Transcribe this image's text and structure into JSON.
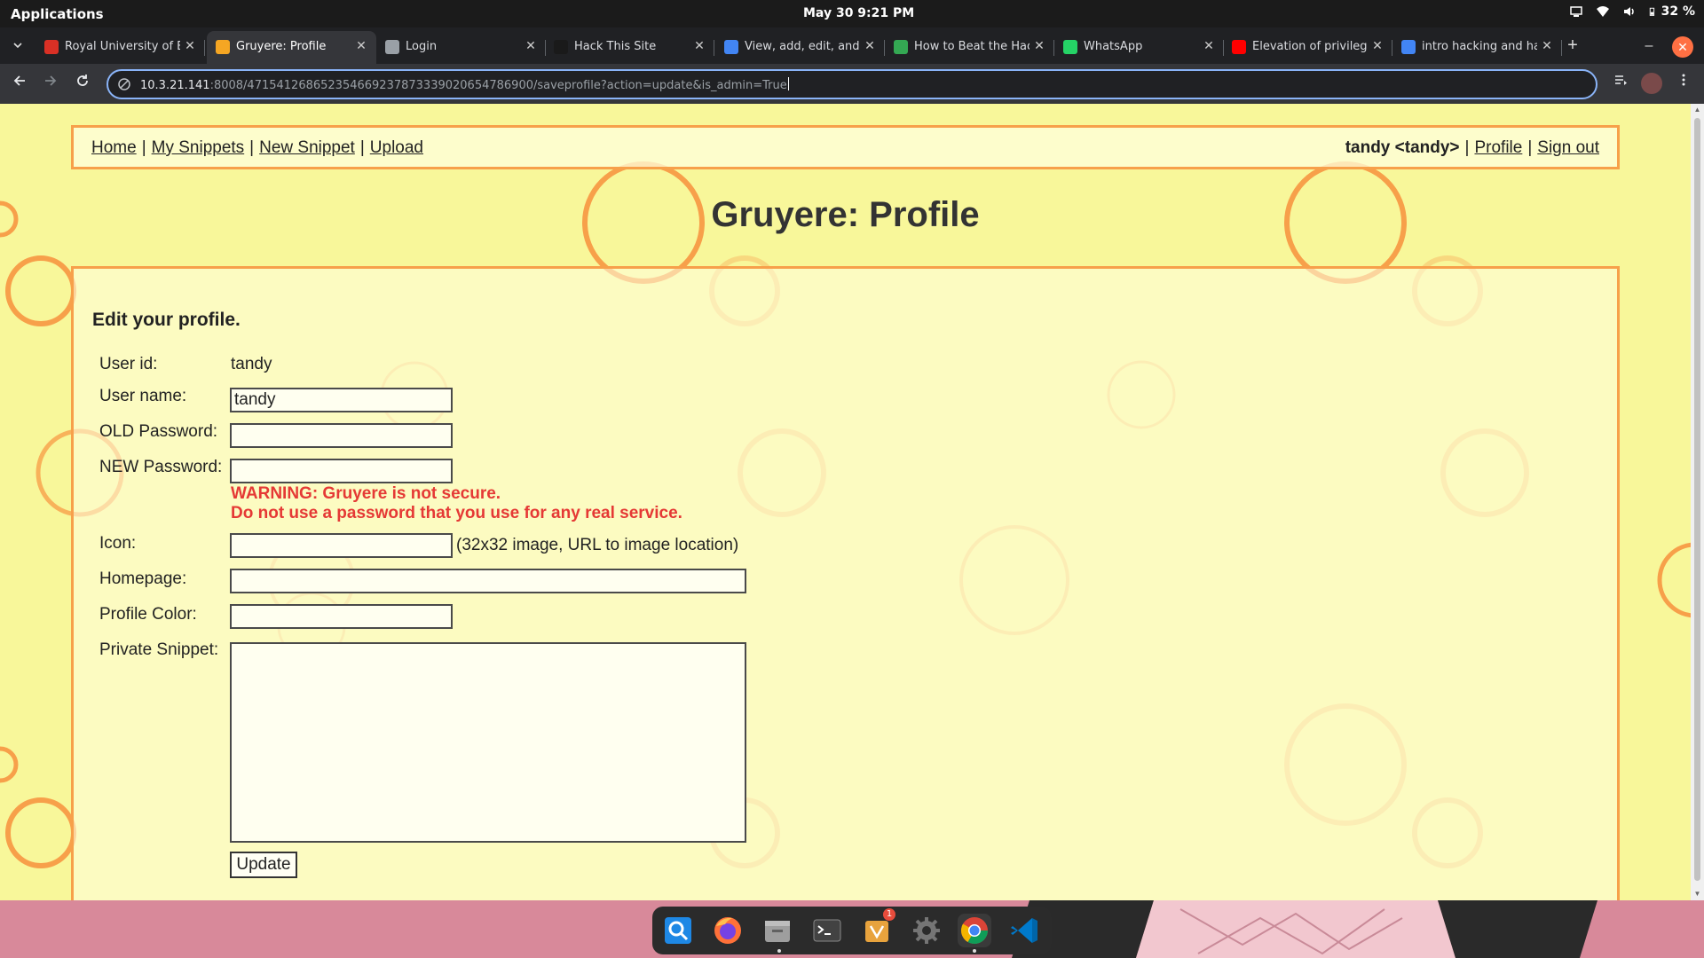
{
  "system": {
    "apps_label": "Applications",
    "clock": "May 30  9:21 PM",
    "battery": "32 %"
  },
  "browser": {
    "tabs": [
      {
        "label": "Royal University of B",
        "icon": "gmail-icon",
        "color": "#d93025",
        "active": false
      },
      {
        "label": "Gruyere: Profile",
        "icon": "gruyere-icon",
        "color": "#f5a623",
        "active": true
      },
      {
        "label": "Login",
        "icon": "globe-icon",
        "color": "#9aa0a6",
        "active": false
      },
      {
        "label": "Hack This Site",
        "icon": "hts-icon",
        "color": "#1a1a1a",
        "active": false
      },
      {
        "label": "View, add, edit, and",
        "icon": "google-icon",
        "color": "#4285f4",
        "active": false
      },
      {
        "label": "How to Beat the Hac",
        "icon": "site-icon",
        "color": "#34a853",
        "active": false
      },
      {
        "label": "WhatsApp",
        "icon": "whatsapp-icon",
        "color": "#25d366",
        "active": false
      },
      {
        "label": "Elevation of privileg",
        "icon": "youtube-icon",
        "color": "#ff0000",
        "active": false
      },
      {
        "label": "intro hacking and ha",
        "icon": "docs-icon",
        "color": "#4285f4",
        "active": false
      }
    ],
    "url_host": "10.3.21.141",
    "url_rest": ":8008/471541268652354669237873339020654786900/saveprofile?action=update&is_admin=True"
  },
  "page": {
    "nav": {
      "home": "Home",
      "my_snippets": "My Snippets",
      "new_snippet": "New Snippet",
      "upload": "Upload",
      "separator": "|",
      "user_display": "tandy <tandy>",
      "profile": "Profile",
      "sign_out": "Sign out"
    },
    "title": "Gruyere: Profile",
    "heading": "Edit your profile.",
    "form": {
      "user_id_label": "User id:",
      "user_id_value": "tandy",
      "user_name_label": "User name:",
      "user_name_value": "tandy",
      "old_password_label": "OLD Password:",
      "new_password_label": "NEW Password:",
      "warning_line1": "WARNING: Gruyere is not secure.",
      "warning_line2": "Do not use a password that you use for any real service.",
      "icon_label": "Icon:",
      "icon_hint": "(32x32 image, URL to image location)",
      "homepage_label": "Homepage:",
      "profile_color_label": "Profile Color:",
      "private_snippet_label": "Private Snippet:",
      "update_label": "Update"
    }
  },
  "dock": {
    "items": [
      "search-app-icon",
      "firefox-icon",
      "files-icon",
      "terminal-icon",
      "software-icon",
      "settings-icon",
      "chrome-icon",
      "vscode-icon"
    ],
    "software_badge": "1"
  },
  "colors": {
    "page_bg": "#f8f79a",
    "accent_border": "#f7a04a",
    "warning": "#e53935"
  }
}
